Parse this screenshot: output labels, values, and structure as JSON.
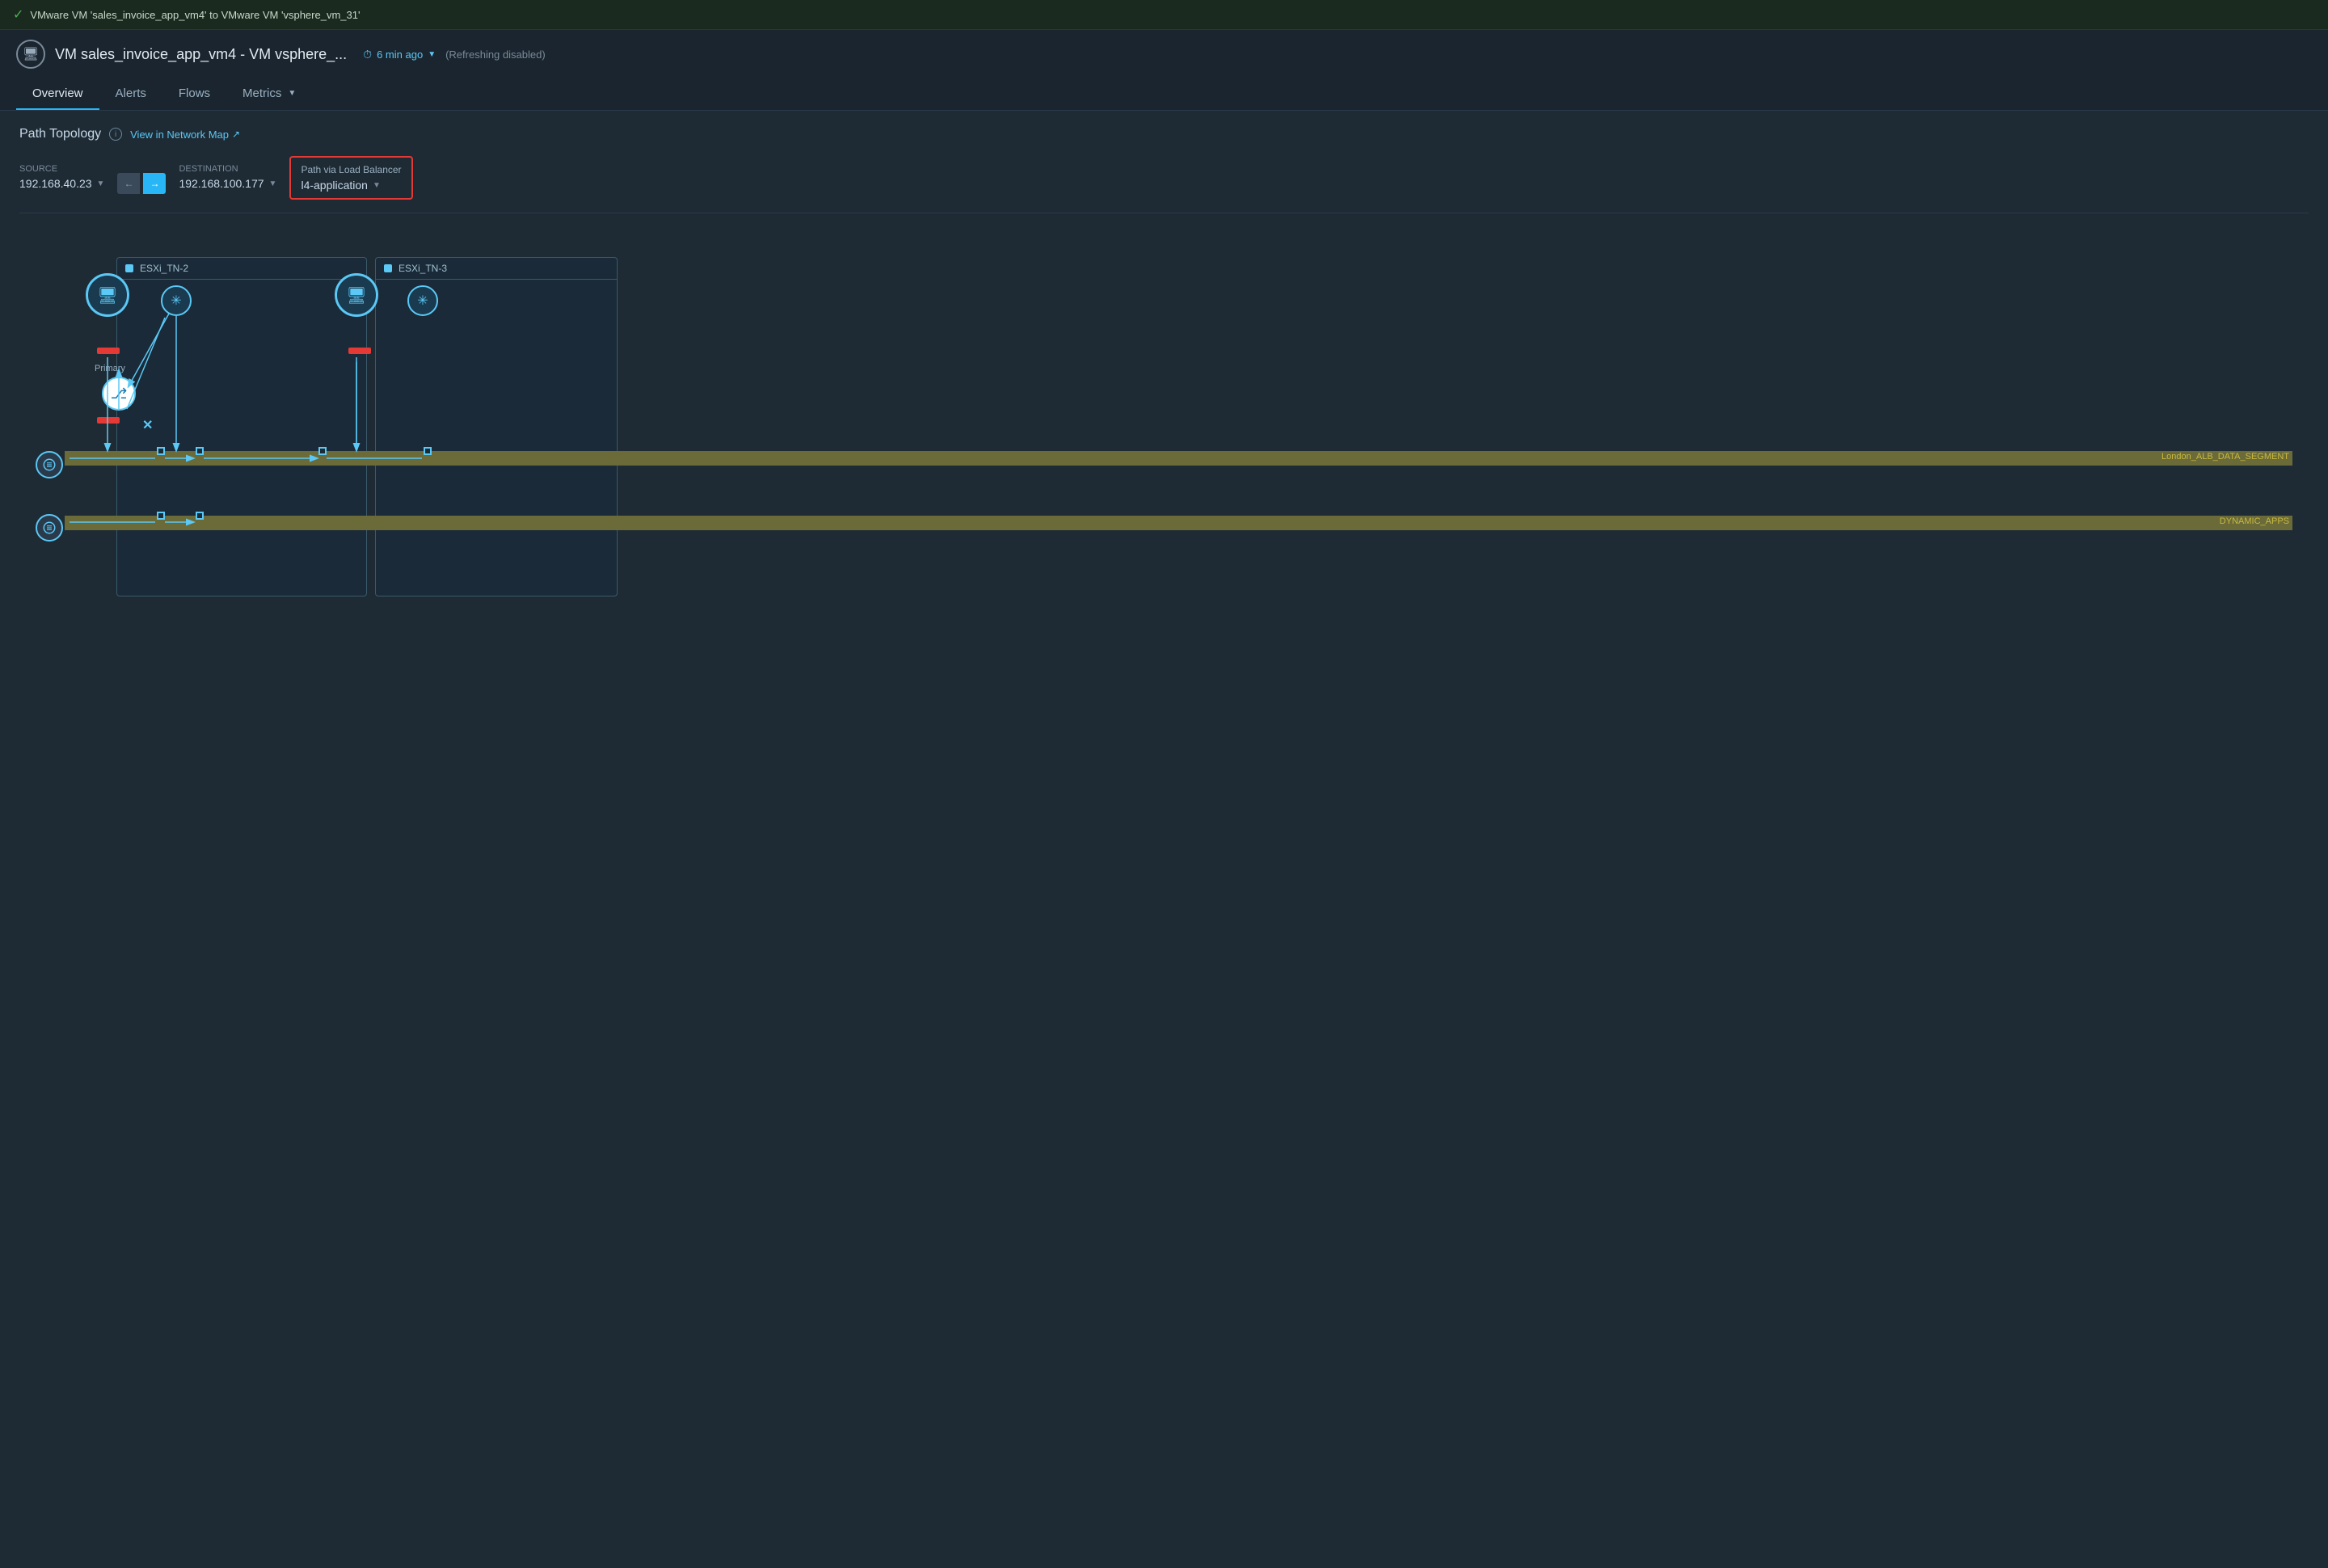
{
  "notification": {
    "text": "VMware VM 'sales_invoice_app_vm4' to VMware VM 'vsphere_vm_31'"
  },
  "header": {
    "vm_icon": "🖥",
    "title": "VM sales_invoice_app_vm4 - VM vsphere_...",
    "time_ago": "6 min ago",
    "refreshing_status": "(Refreshing  disabled)"
  },
  "tabs": [
    {
      "label": "Overview",
      "active": true
    },
    {
      "label": "Alerts",
      "active": false
    },
    {
      "label": "Flows",
      "active": false
    },
    {
      "label": "Metrics",
      "active": false,
      "has_chevron": true
    }
  ],
  "path_topology": {
    "title": "Path Topology",
    "network_map_link": "View in Network Map",
    "source_label": "Source",
    "source_ip": "192.168.40.23",
    "destination_label": "Destination",
    "destination_ip": "192.168.100.177",
    "path_via_label": "Path via Load Balancer",
    "path_via_value": "l4-application"
  },
  "topology": {
    "esxi_tn2_label": "ESXi_TN-2",
    "esxi_tn3_label": "ESXi_TN-3",
    "primary_label": "Primary",
    "segment1_label": "London_ALB_DATA_SEGMENT",
    "segment2_label": "DYNAMIC_APPS"
  }
}
